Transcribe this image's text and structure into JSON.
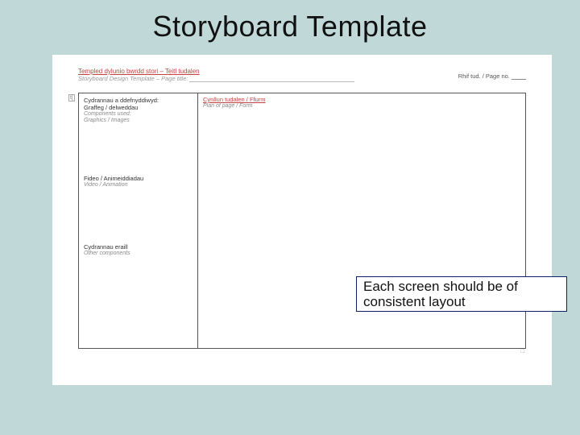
{
  "title": "Storyboard Template",
  "doc": {
    "header_red": "Templed dylunio bwrdd stori – Teitl tudalen",
    "header_grey_prefix": "Storyboard Design Template – Page title:",
    "meta_label": "Rhif tud. / Page no.",
    "bracket": "t[",
    "sections": {
      "a": {
        "l1": "Cydrannau a ddefnyddiwyd:",
        "l2": "Graffeg / delweddau",
        "l3": "Components used:",
        "l4": "Graphics / Images"
      },
      "b": {
        "l1": "Fideo / Animeiddiadau",
        "l3": "Video / Animation"
      },
      "c": {
        "l1": "Cydrannau eraill",
        "l3": "Other components"
      },
      "right": {
        "l1": "Cynllun tudalen / Ffurm",
        "l2": "Plan of page / Form"
      }
    },
    "tiny_mark": "□"
  },
  "callout": "Each screen should be of consistent layout"
}
